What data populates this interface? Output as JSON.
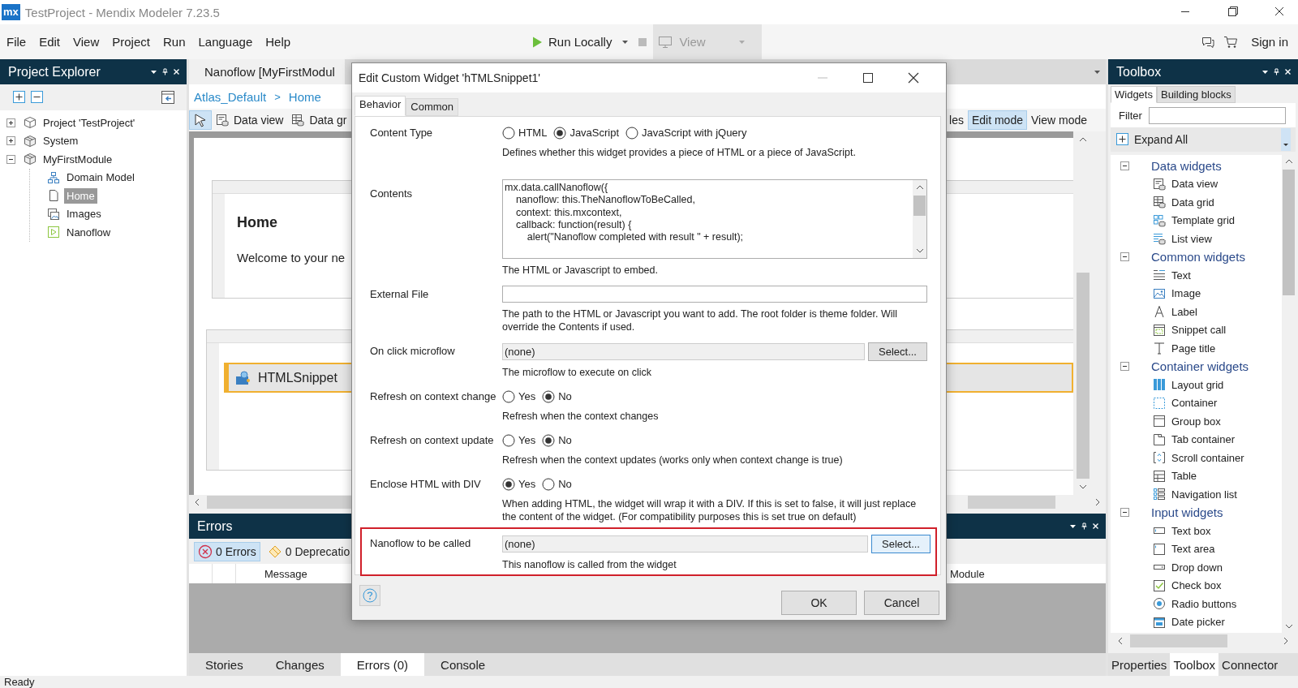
{
  "window": {
    "logo": "mx",
    "title": "TestProject - Mendix Modeler 7.23.5"
  },
  "menu": [
    "File",
    "Edit",
    "View",
    "Project",
    "Run",
    "Language",
    "Help"
  ],
  "run_toolbar": {
    "run": "Run Locally",
    "view": "View",
    "view_disabled": true
  },
  "account": {
    "sign_in": "Sign in"
  },
  "project_explorer": {
    "title": "Project Explorer",
    "tree": [
      {
        "label": "Project 'TestProject'",
        "kind": "project",
        "expanded": false,
        "selected": false
      },
      {
        "label": "System",
        "kind": "module",
        "expanded": false,
        "selected": false
      },
      {
        "label": "MyFirstModule",
        "kind": "module",
        "expanded": true,
        "selected": false,
        "children": [
          {
            "label": "Domain Model",
            "kind": "domain-model",
            "selected": false
          },
          {
            "label": "Home",
            "kind": "page",
            "selected": true
          },
          {
            "label": "Images",
            "kind": "images",
            "selected": false
          },
          {
            "label": "Nanoflow",
            "kind": "nanoflow",
            "selected": false
          }
        ]
      }
    ]
  },
  "document": {
    "tab": "Nanoflow [MyFirstModul",
    "breadcrumb": {
      "items": [
        "Atlas_Default",
        "Home"
      ],
      "separator": ">"
    },
    "tools": [
      {
        "label": "Data view",
        "kind": "data-view"
      },
      {
        "label": "Data gr",
        "kind": "data-grid"
      }
    ],
    "modes": [
      {
        "label": "les",
        "selected": false
      },
      {
        "label": "Edit mode",
        "selected": true
      },
      {
        "label": "View mode",
        "selected": false
      }
    ],
    "canvas": {
      "heading": "Home",
      "text": "Welcome to your ne",
      "widget": "HTMLSnippet"
    }
  },
  "errors": {
    "title": "Errors",
    "filters": [
      {
        "label": "0 Errors",
        "kind": "error",
        "selected": true
      },
      {
        "label": "0 Deprecatio",
        "kind": "deprecation",
        "selected": false
      }
    ],
    "columns": [
      "Message",
      "Module"
    ]
  },
  "bottom_tabs": [
    {
      "label": "Stories",
      "selected": false
    },
    {
      "label": "Changes",
      "selected": false
    },
    {
      "label": "Errors (0)",
      "selected": true
    },
    {
      "label": "Console",
      "selected": false
    }
  ],
  "toolbox": {
    "title": "Toolbox",
    "tabs": [
      {
        "label": "Widgets",
        "selected": true
      },
      {
        "label": "Building blocks",
        "selected": false
      }
    ],
    "filter_label": "Filter",
    "expand_all": "Expand All",
    "groups": [
      {
        "label": "Data widgets",
        "expanded": true,
        "children": [
          {
            "label": "Data view",
            "kind": "data-view"
          },
          {
            "label": "Data grid",
            "kind": "data-grid"
          },
          {
            "label": "Template grid",
            "kind": "template-grid"
          },
          {
            "label": "List view",
            "kind": "list-view"
          }
        ]
      },
      {
        "label": "Common widgets",
        "expanded": true,
        "children": [
          {
            "label": "Text",
            "kind": "text"
          },
          {
            "label": "Image",
            "kind": "image"
          },
          {
            "label": "Label",
            "kind": "label"
          },
          {
            "label": "Snippet call",
            "kind": "snippet-call"
          },
          {
            "label": "Page title",
            "kind": "page-title"
          }
        ]
      },
      {
        "label": "Container widgets",
        "expanded": true,
        "children": [
          {
            "label": "Layout grid",
            "kind": "layout-grid"
          },
          {
            "label": "Container",
            "kind": "container"
          },
          {
            "label": "Group box",
            "kind": "group-box"
          },
          {
            "label": "Tab container",
            "kind": "tab-container"
          },
          {
            "label": "Scroll container",
            "kind": "scroll-container"
          },
          {
            "label": "Table",
            "kind": "table"
          },
          {
            "label": "Navigation list",
            "kind": "navigation-list"
          }
        ]
      },
      {
        "label": "Input widgets",
        "expanded": true,
        "children": [
          {
            "label": "Text box",
            "kind": "text-box"
          },
          {
            "label": "Text area",
            "kind": "text-area"
          },
          {
            "label": "Drop down",
            "kind": "drop-down"
          },
          {
            "label": "Check box",
            "kind": "check-box"
          },
          {
            "label": "Radio buttons",
            "kind": "radio-buttons"
          },
          {
            "label": "Date picker",
            "kind": "date-picker"
          }
        ]
      }
    ],
    "bottom_tabs": [
      {
        "label": "Properties",
        "selected": false
      },
      {
        "label": "Toolbox",
        "selected": true
      },
      {
        "label": "Connector",
        "selected": false
      }
    ]
  },
  "dialog": {
    "title": "Edit Custom Widget 'hTMLSnippet1'",
    "tabs": [
      {
        "label": "Behavior",
        "selected": true
      },
      {
        "label": "Common",
        "selected": false
      }
    ],
    "properties": [
      {
        "label": "Content Type",
        "kind": "radio",
        "options": [
          {
            "label": "HTML",
            "selected": false
          },
          {
            "label": "JavaScript",
            "selected": true
          },
          {
            "label": "JavaScript with jQuery",
            "selected": false
          }
        ],
        "description": "Defines whether this widget provides a piece of HTML or a piece of JavaScript."
      },
      {
        "label": "Contents",
        "kind": "code",
        "lines": [
          "mx.data.callNanoflow({",
          "    nanoflow: this.TheNanoflowToBeCalled,",
          "    context: this.mxcontext,",
          "    callback: function(result) {",
          "        alert(\"Nanoflow completed with result \" + result);"
        ],
        "description": "The HTML or Javascript to embed."
      },
      {
        "label": "External File",
        "kind": "text",
        "description": "The path to the HTML or Javascript you want to add. The root folder is theme folder. Will override the Contents if used."
      },
      {
        "label": "On click microflow",
        "kind": "select",
        "value": "(none)",
        "button": "Select...",
        "description": "The microflow to execute on click"
      },
      {
        "label": "Refresh on context change",
        "kind": "radio",
        "options": [
          {
            "label": "Yes",
            "selected": false
          },
          {
            "label": "No",
            "selected": true
          }
        ],
        "description": "Refresh when the context changes"
      },
      {
        "label": "Refresh on context update",
        "kind": "radio",
        "options": [
          {
            "label": "Yes",
            "selected": false
          },
          {
            "label": "No",
            "selected": true
          }
        ],
        "description": "Refresh when the context updates (works only when context change is true)"
      },
      {
        "label": "Enclose HTML with DIV",
        "kind": "radio",
        "options": [
          {
            "label": "Yes",
            "selected": true
          },
          {
            "label": "No",
            "selected": false
          }
        ],
        "description": "When adding HTML, the widget will wrap it with a DIV. If this is set to false, it will just replace the content of the widget. (For compatibility purposes this is set true on default)"
      },
      {
        "label": "Nanoflow to be called",
        "kind": "select",
        "value": "(none)",
        "button": "Select...",
        "description": "This nanoflow is called from the widget",
        "highlighted": true
      }
    ],
    "buttons": [
      "OK",
      "Cancel"
    ]
  },
  "status_bar": "Ready"
}
